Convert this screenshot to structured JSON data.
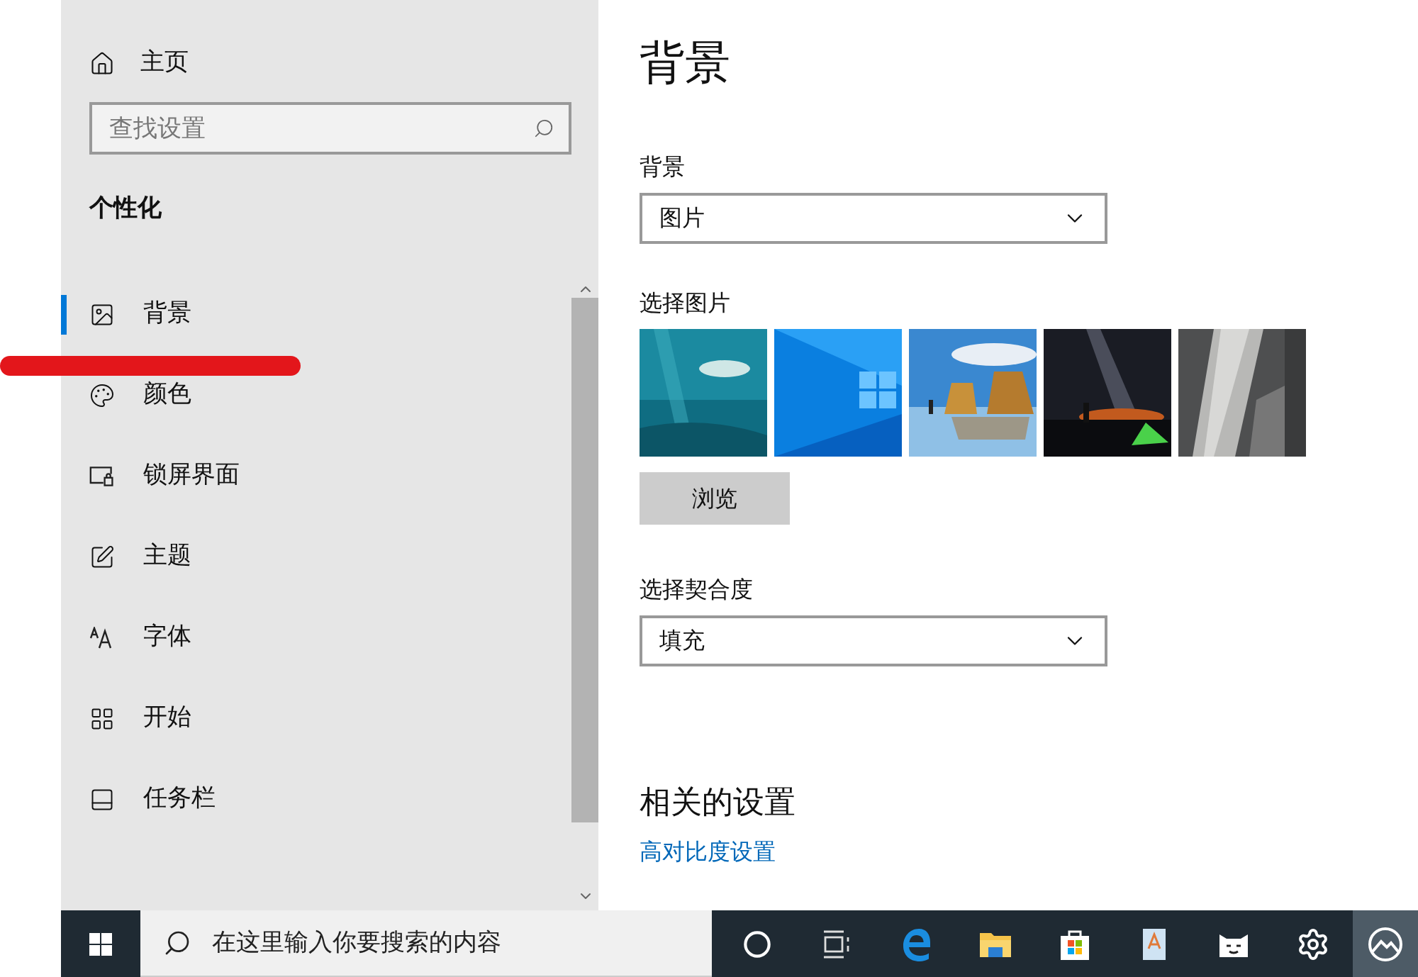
{
  "sidebar": {
    "home": "主页",
    "search": {
      "placeholder": "查找设置"
    },
    "section": "个性化",
    "items": [
      {
        "label": "背景",
        "selected": true
      },
      {
        "label": "颜色",
        "selected": false
      },
      {
        "label": "锁屏界面",
        "selected": false
      },
      {
        "label": "主题",
        "selected": false
      },
      {
        "label": "字体",
        "selected": false
      },
      {
        "label": "开始",
        "selected": false
      },
      {
        "label": "任务栏",
        "selected": false
      }
    ]
  },
  "content": {
    "title": "背景",
    "background_label": "背景",
    "background_value": "图片",
    "pictures_label": "选择图片",
    "browse_button": "浏览",
    "fit_label": "选择契合度",
    "fit_value": "填充",
    "related_heading": "相关的设置",
    "related_link": "高对比度设置"
  },
  "taskbar": {
    "search": {
      "placeholder": "在这里输入你要搜索的内容"
    },
    "apps": [
      {
        "selected": false
      },
      {
        "selected": false
      },
      {
        "selected": false
      },
      {
        "selected": false
      },
      {
        "selected": false
      },
      {
        "selected": false
      },
      {
        "selected": false
      },
      {
        "selected": false
      },
      {
        "selected": true
      }
    ]
  }
}
